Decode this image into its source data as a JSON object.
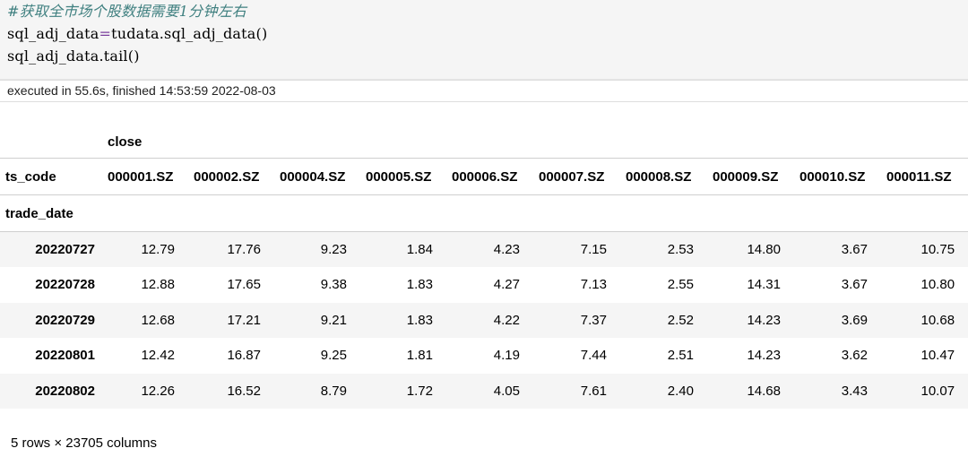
{
  "code_cell": {
    "line1": "#获取全市场个股数据需要1分钟左右",
    "line2_a": "sql_adj_data",
    "line2_op": "=",
    "line2_b": "tudata.sql_adj_data()",
    "line3": "sql_adj_data.tail()"
  },
  "execution_info": "executed in 55.6s, finished 14:53:59 2022-08-03",
  "table": {
    "column_group": "close",
    "index_names": {
      "columns_name": "ts_code",
      "row_name": "trade_date"
    },
    "columns": [
      "000001.SZ",
      "000002.SZ",
      "000004.SZ",
      "000005.SZ",
      "000006.SZ",
      "000007.SZ",
      "000008.SZ",
      "000009.SZ",
      "000010.SZ",
      "000011.SZ"
    ],
    "rows": [
      {
        "date": "20220727",
        "values": [
          "12.79",
          "17.76",
          "9.23",
          "1.84",
          "4.23",
          "7.15",
          "2.53",
          "14.80",
          "3.67",
          "10.75"
        ]
      },
      {
        "date": "20220728",
        "values": [
          "12.88",
          "17.65",
          "9.38",
          "1.83",
          "4.27",
          "7.13",
          "2.55",
          "14.31",
          "3.67",
          "10.80"
        ]
      },
      {
        "date": "20220729",
        "values": [
          "12.68",
          "17.21",
          "9.21",
          "1.83",
          "4.22",
          "7.37",
          "2.52",
          "14.23",
          "3.69",
          "10.68"
        ]
      },
      {
        "date": "20220801",
        "values": [
          "12.42",
          "16.87",
          "9.25",
          "1.81",
          "4.19",
          "7.44",
          "2.51",
          "14.23",
          "3.62",
          "10.47"
        ]
      },
      {
        "date": "20220802",
        "values": [
          "12.26",
          "16.52",
          "8.79",
          "1.72",
          "4.05",
          "7.61",
          "2.40",
          "14.68",
          "3.43",
          "10.07"
        ]
      }
    ]
  },
  "footer": "5 rows × 23705 columns"
}
